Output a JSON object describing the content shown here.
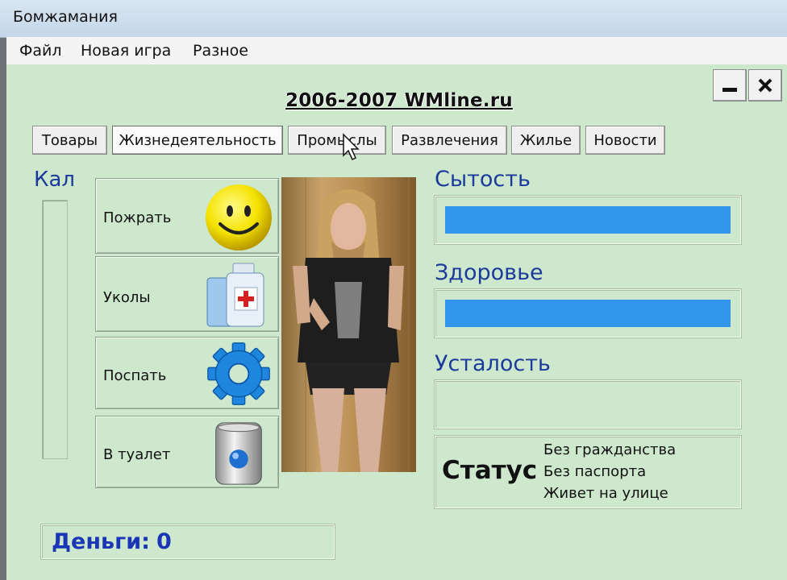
{
  "window": {
    "title": "Бомжамания",
    "minimize_label": "—",
    "close_label": "✕"
  },
  "menu": [
    "Файл",
    "Новая игра",
    "Разное"
  ],
  "copyright": "2006-2007 WMline.ru",
  "tabs": [
    "Товары",
    "Жизнедеятельность",
    "Промыслы",
    "Развлечения",
    "Жилье",
    "Новости"
  ],
  "active_tab": "Жизнедеятельность",
  "kal": {
    "label": "Кал",
    "value": 0
  },
  "actions": [
    {
      "label": "Пожрать",
      "icon": "smiley-icon"
    },
    {
      "label": "Уколы",
      "icon": "medicine-bottles-icon"
    },
    {
      "label": "Поспать",
      "icon": "gear-icon"
    },
    {
      "label": "В туалет",
      "icon": "toilet-icon"
    }
  ],
  "stats": {
    "satiety": {
      "label": "Сытость",
      "value": 1.0
    },
    "health": {
      "label": "Здоровье",
      "value": 1.0
    },
    "fatigue": {
      "label": "Усталость",
      "value": 0.0
    }
  },
  "status": {
    "heading": "Статус",
    "lines": [
      "Без гражданства",
      "Без паспорта",
      "Живет на улице"
    ]
  },
  "money": {
    "label": "Деньги:",
    "value": "0"
  },
  "colors": {
    "background": "#cde8cc",
    "bar_fill": "#3296ec",
    "label_blue": "#1c3a9c",
    "money_blue": "#1a35b5"
  }
}
